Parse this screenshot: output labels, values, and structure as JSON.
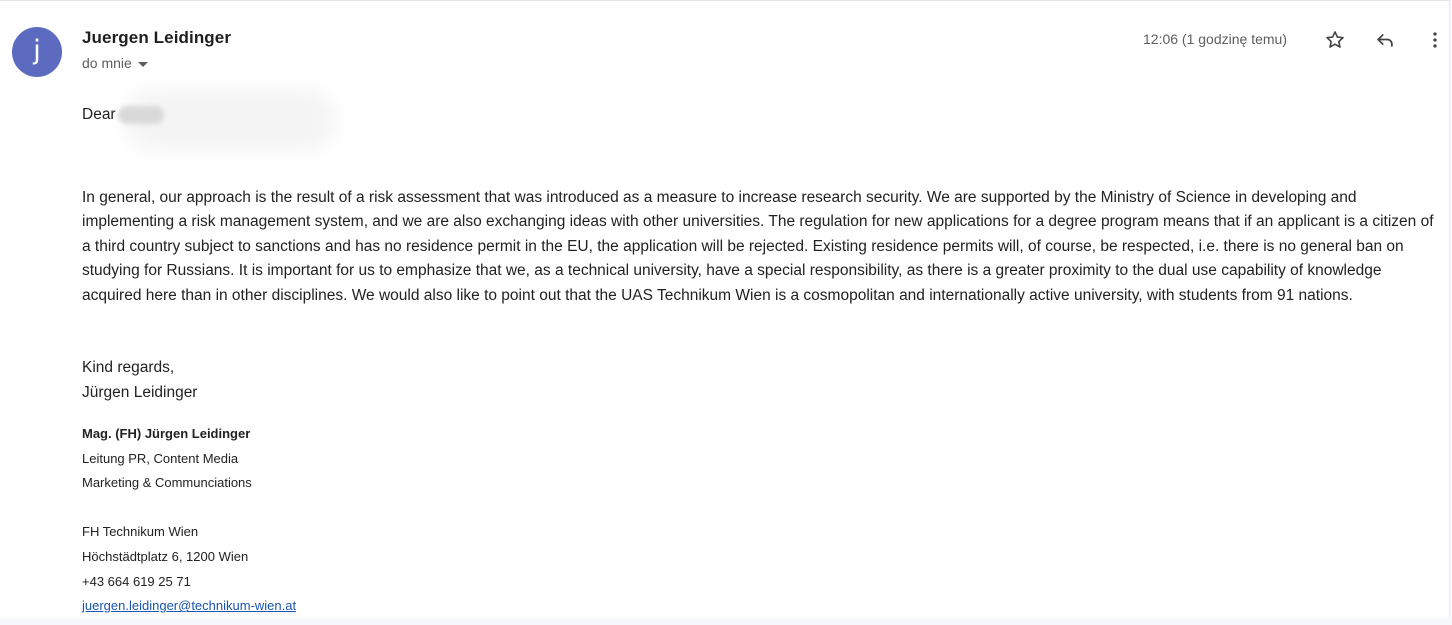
{
  "message": {
    "avatar_letter": "j",
    "sender_name": "Juergen Leidinger",
    "recipient": "do mnie",
    "timestamp": "12:06 (1 godzinę temu)",
    "icons": [
      "star-icon",
      "reply-icon",
      "more-vert-icon",
      "chevron-down-icon"
    ],
    "colors": {
      "avatar_bg": "#5c6bc0",
      "link": "#1a55b0"
    }
  },
  "body": {
    "greeting": "Dear",
    "paragraph": "In general, our approach is the result of a risk assessment that was introduced as a measure to increase research security. We are supported by the Ministry of Science in developing and implementing a risk management system, and we are also exchanging ideas with other universities. The regulation for new applications for a degree program means that if an applicant is a citizen of a third country subject to sanctions and has no residence permit in the EU, the application will be rejected. Existing residence permits will, of course, be respected, i.e. there is no general ban on studying for Russians. It is important for us to emphasize that we, as a technical university, have a special responsibility, as there is a greater proximity to the dual use capability of knowledge acquired here than in other disciplines. We would also like to point out that the UAS Technikum Wien is a cosmopolitan and internationally active university, with students from 91 nations.",
    "closing_line1": "Kind regards,",
    "closing_line2": "Jürgen Leidinger"
  },
  "signature": {
    "name": "Mag. (FH) Jürgen Leidinger",
    "title1": "Leitung PR, Content Media",
    "title2": "Marketing & Communciations",
    "org": "FH Technikum Wien",
    "address": "Höchstädtplatz 6, 1200 Wien",
    "phone": "+43 664 619 25 71",
    "email": "juergen.leidinger@technikum-wien.at"
  }
}
